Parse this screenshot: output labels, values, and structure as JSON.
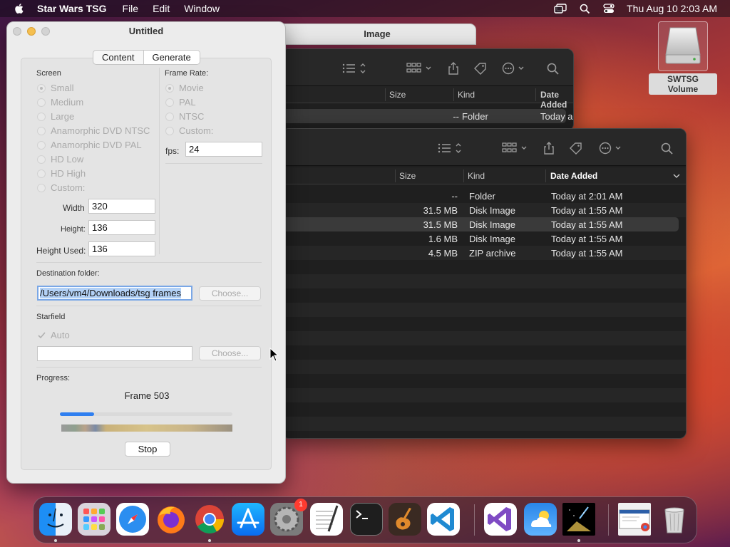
{
  "menubar": {
    "app_name": "Star Wars TSG",
    "menus": [
      "File",
      "Edit",
      "Window"
    ],
    "clock": "Thu Aug 10  2:03 AM"
  },
  "desktop": {
    "volume_label": "SWTSG Volume"
  },
  "image_window": {
    "title": "Image"
  },
  "finder_back": {
    "columns": [
      "Size",
      "Kind",
      "Date Added"
    ],
    "rows": [
      {
        "size": "--",
        "kind": "Folder",
        "date": "Today a"
      }
    ]
  },
  "finder_front": {
    "columns": [
      "Size",
      "Kind",
      "Date Added"
    ],
    "rows": [
      {
        "size": "--",
        "kind": "Folder",
        "date": "Today at 2:01 AM"
      },
      {
        "size": "31.5 MB",
        "kind": "Disk Image",
        "date": "Today at 1:55 AM"
      },
      {
        "size": "31.5 MB",
        "kind": "Disk Image",
        "date": "Today at 1:55 AM"
      },
      {
        "size": "1.6 MB",
        "kind": "Disk Image",
        "date": "Today at 1:55 AM"
      },
      {
        "size": "4.5 MB",
        "kind": "ZIP archive",
        "date": "Today at 1:55 AM"
      }
    ]
  },
  "untitled": {
    "title": "Untitled",
    "tabs": {
      "content": "Content",
      "generate": "Generate"
    },
    "screen": {
      "label": "Screen",
      "options": [
        "Small",
        "Medium",
        "Large",
        "Anamorphic DVD NTSC",
        "Anamorphic DVD PAL",
        "HD Low",
        "HD High",
        "Custom:"
      ],
      "selected": "Small",
      "width_label": "Width",
      "width": "320",
      "height_label": "Height:",
      "height": "136",
      "height_used_label": "Height Used:",
      "height_used": "136"
    },
    "frame_rate": {
      "label": "Frame Rate:",
      "options": [
        "Movie",
        "PAL",
        "NTSC",
        "Custom:"
      ],
      "selected": "Movie",
      "fps_label": "fps:",
      "fps": "24"
    },
    "destination": {
      "label": "Destination folder:",
      "path": "/Users/vm4/Downloads/tsg frames",
      "choose": "Choose..."
    },
    "starfield": {
      "label": "Starfield",
      "auto_label": "Auto",
      "auto_checked": true,
      "path": "",
      "choose": "Choose..."
    },
    "progress": {
      "label": "Progress:",
      "status": "Frame 503",
      "fraction": 0.2,
      "stop": "Stop"
    }
  },
  "dock": {
    "items": [
      "finder",
      "launchpad",
      "safari",
      "firefox",
      "chrome",
      "app-store",
      "system-settings",
      "textedit",
      "terminal",
      "garageband",
      "vscode",
      "visual-studio",
      "weather",
      "star-wars-tsg",
      "preview-window",
      "trash"
    ],
    "settings_badge": "1"
  }
}
